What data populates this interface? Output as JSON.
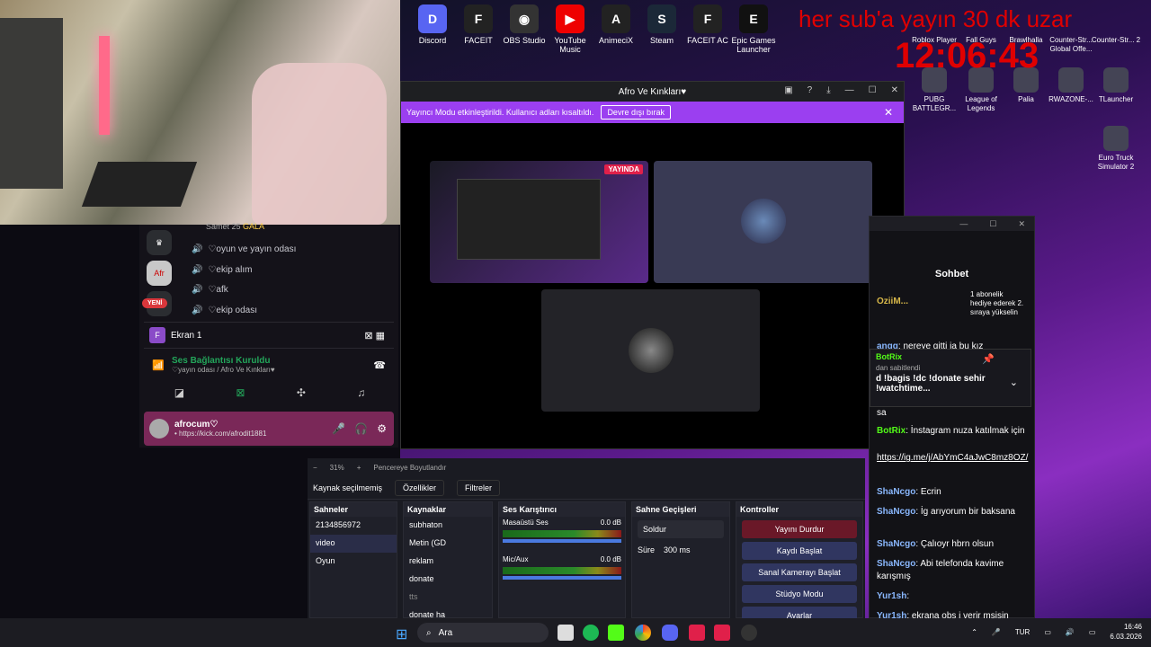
{
  "banner": "her sub'a yayın 30 dk uzar",
  "clock": "12:06:43",
  "desktop_icons": [
    {
      "label": "Discord",
      "color": "#5865f2",
      "glyph": "D"
    },
    {
      "label": "FACEIT",
      "color": "#222",
      "glyph": "F"
    },
    {
      "label": "OBS Studio",
      "color": "#333",
      "glyph": "◉"
    },
    {
      "label": "YouTube Music",
      "color": "#e00",
      "glyph": "▶"
    },
    {
      "label": "AnimeciX",
      "color": "#222",
      "glyph": "A"
    },
    {
      "label": "Steam",
      "color": "#1b2838",
      "glyph": "S"
    },
    {
      "label": "FACEIT AC",
      "color": "#222",
      "glyph": "F"
    },
    {
      "label": "Epic Games Launcher",
      "color": "#111",
      "glyph": "E"
    }
  ],
  "desktop_icons_right": [
    {
      "label": "Roblox Player"
    },
    {
      "label": "Fall Guys"
    },
    {
      "label": "Brawlhalla"
    },
    {
      "label": "Counter-Str... Global Offe..."
    },
    {
      "label": "Counter-Str... 2"
    },
    {
      "label": "PUBG BATTLEGR..."
    },
    {
      "label": "League of Legends"
    },
    {
      "label": "Palia"
    },
    {
      "label": "RWAZONE-..."
    },
    {
      "label": "TLauncher"
    },
    {
      "label": "Euro Truck Simulator 2"
    }
  ],
  "discord": {
    "title": "Afro Ve Kınkları♥",
    "streamer_mode": "Yayıncı Modu etkinleştirildi. Kullanıcı adları kısaltıldı.",
    "disable_btn": "Devre dışı bırak",
    "live_badge": "YAYINDA",
    "user25": "Samet 25",
    "gala": "GALA",
    "channels": [
      "♡oyun ve yayın odası",
      "♡ekip alım",
      "♡afk",
      "♡ekip odası"
    ],
    "yeni": "YENİ",
    "ekran": "Ekran 1",
    "ekran_av": "F",
    "voice_title": "Ses Bağlantısı Kuruldu",
    "voice_sub": "♡yayın odası / Afro Ve Kınkları♥",
    "username": "afrocum♡",
    "status": "• https://kick.com/afrodit1881"
  },
  "obs": {
    "zoom": "31%",
    "fit": "Pencereye Boyutlandır",
    "no_source": "Kaynak seçilmemiş",
    "props": "Özellikler",
    "filters": "Filtreler",
    "scenes_h": "Sahneler",
    "scenes": [
      "2134856972",
      "video",
      "Oyun"
    ],
    "sources_h": "Kaynaklar",
    "sources": [
      "subhaton",
      "Metin (GD",
      "reklam",
      "donate",
      "tts",
      "donate ha"
    ],
    "mixer_h": "Ses Karıştırıcı",
    "mixer": [
      {
        "name": "Masaüstü Ses",
        "db": "0.0 dB"
      },
      {
        "name": "Mic/Aux",
        "db": "0.0 dB"
      }
    ],
    "trans_h": "Sahne Geçişleri",
    "trans": "Soldur",
    "dur_label": "Süre",
    "dur": "300 ms",
    "ctrl_h": "Kontroller",
    "ctrl": [
      "Yayını Durdur",
      "Kaydı Başlat",
      "Sanal Kamerayı Başlat",
      "Stüdyo Modu",
      "Ayarlar"
    ]
  },
  "chat": {
    "title": "Sohbet",
    "top_user": "OziiM...",
    "top_note": "1 abonelik hediye ederek 2. sıraya yükselin",
    "pinned_user": "BotRix",
    "pinned_label": "dan sabitlendi",
    "pinned_text": "d !bagis !dc !donate sehir !watchtime...",
    "messages": [
      {
        "user": "angg",
        "text": "nereye gitti ja bu kız"
      },
      {
        "user": "",
        "text": "sa"
      },
      {
        "user": "BotRix",
        "text": "İnstagram nuza katılmak için"
      },
      {
        "user": "",
        "text": "https://ig.me/j/AbYmC4aJwC8mz8OZ/"
      },
      {
        "user": "ShaNcgo",
        "text": "Ecrin"
      },
      {
        "user": "ShaNcgo",
        "text": "İg arıyorum bir baksana"
      },
      {
        "user": "ShaNcgo",
        "text": "Çalıoyr hbrn olsun"
      },
      {
        "user": "ShaNcgo",
        "text": "Abi telefonda kavime karışmış"
      },
      {
        "user": "Yur1sh",
        "text": ""
      },
      {
        "user": "Yur1sh",
        "text": "ekrana obs i verir msisin"
      }
    ]
  },
  "taskbar": {
    "search": "Ara",
    "lang": "TUR",
    "time": "16:46",
    "date": "6.03.2026"
  }
}
